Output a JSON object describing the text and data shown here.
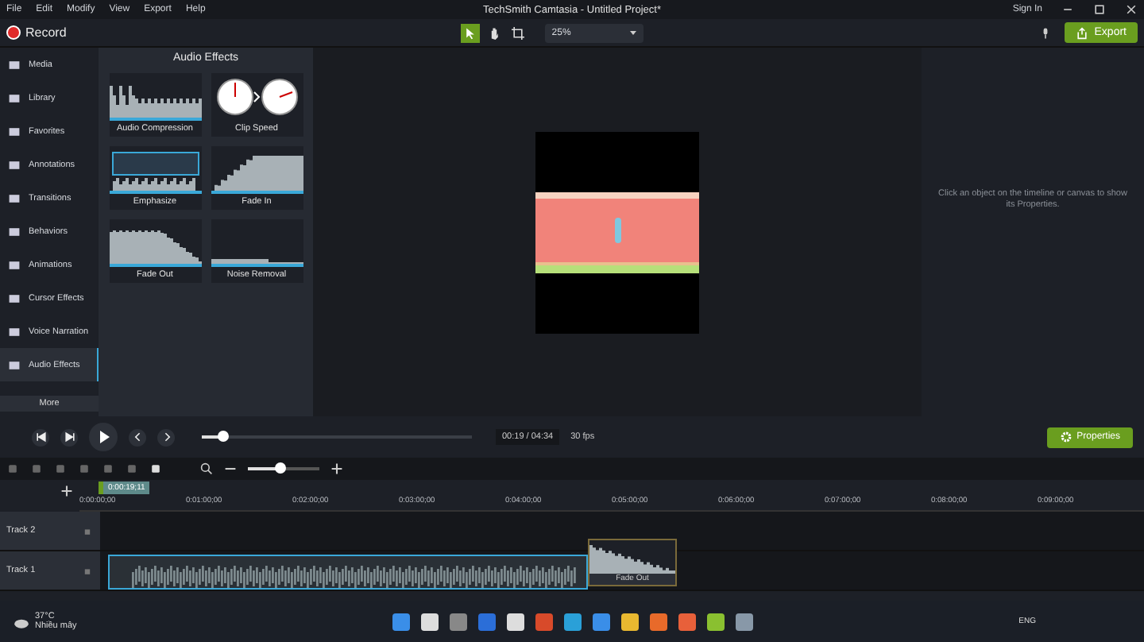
{
  "menu": [
    "File",
    "Edit",
    "Modify",
    "View",
    "Export",
    "Help"
  ],
  "title": "TechSmith Camtasia - Untitled Project*",
  "sign_in": "Sign In",
  "record": "Record",
  "tools": [
    {
      "kind": "pointer",
      "selected": true
    },
    {
      "kind": "hand",
      "selected": false
    },
    {
      "kind": "crop",
      "selected": false
    }
  ],
  "zoom": "25%",
  "export": "Export",
  "nav": [
    {
      "label": "Media",
      "selected": false
    },
    {
      "label": "Library",
      "selected": false
    },
    {
      "label": "Favorites",
      "selected": false
    },
    {
      "label": "Annotations",
      "selected": false
    },
    {
      "label": "Transitions",
      "selected": false
    },
    {
      "label": "Behaviors",
      "selected": false
    },
    {
      "label": "Animations",
      "selected": false
    },
    {
      "label": "Cursor Effects",
      "selected": false
    },
    {
      "label": "Voice Narration",
      "selected": false
    },
    {
      "label": "Audio Effects",
      "selected": true
    }
  ],
  "more": "More",
  "effects_title": "Audio Effects",
  "effects": [
    {
      "label": "Audio Compression",
      "kind": "compression"
    },
    {
      "label": "Clip Speed",
      "kind": "clock"
    },
    {
      "label": "Emphasize",
      "kind": "emphasize"
    },
    {
      "label": "Fade In",
      "kind": "fadein"
    },
    {
      "label": "Fade Out",
      "kind": "fadeout"
    },
    {
      "label": "Noise Removal",
      "kind": "noise"
    }
  ],
  "properties_hint": "Click an object on the timeline or canvas to show its Properties.",
  "playback": {
    "time": "00:19 / 04:34",
    "fps": "30 fps",
    "level": 0.08,
    "properties": "Properties"
  },
  "timeline": {
    "zoom": {
      "level": 0.45
    },
    "playhead": "0:00:19;11",
    "ticks": [
      "0:00:00;00",
      "0:01:00;00",
      "0:02:00;00",
      "0:03:00;00",
      "0:04:00;00",
      "0:05:00;00",
      "0:06:00;00",
      "0:07:00;00",
      "0:08:00;00",
      "0:09:00;00"
    ],
    "tracks": [
      {
        "name": "Track 2"
      },
      {
        "name": "Track 1"
      }
    ],
    "clip_label": "Fade Out"
  },
  "taskbar": {
    "temp": "37°C",
    "weather": "Nhiều mây",
    "lang": "ENG"
  }
}
